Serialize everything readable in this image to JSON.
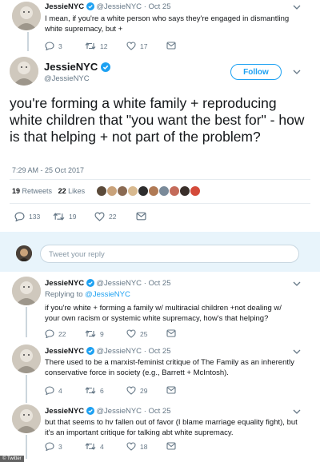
{
  "tweet_top": {
    "name": "JessieNYC",
    "handle": "@JessieNYC",
    "date": "Oct 25",
    "text": "I mean, if you're a white person who says they're engaged in dismantling white supremacy, but +",
    "replies": "3",
    "retweets": "12",
    "likes": "17"
  },
  "main_tweet": {
    "name": "JessieNYC",
    "handle": "@JessieNYC",
    "follow_label": "Follow",
    "text": "you're forming a white family + reproducing white children that \"you want the best for\" - how is that helping + not part of the problem?",
    "timestamp": "7:29 AM - 25 Oct 2017",
    "retweets_count": "19",
    "retweets_label": "Retweets",
    "likes_count": "22",
    "likes_label": "Likes",
    "liker_colors": [
      "#5b4a3a",
      "#c9a27a",
      "#8a6a52",
      "#d8b98f",
      "#2d2d2d",
      "#b07a55",
      "#7a8a99",
      "#c46b5a",
      "#3a2f2a",
      "#d44a3a"
    ],
    "replies": "133",
    "retweets": "19",
    "likes": "22"
  },
  "reply_box": {
    "placeholder": "Tweet your reply"
  },
  "replies": [
    {
      "name": "JessieNYC",
      "handle": "@JessieNYC",
      "date": "Oct 25",
      "replying_prefix": "Replying to",
      "replying_to": "@JessieNYC",
      "text": "if you're white + forming a family w/ multiracial children +not dealing w/ your own racism or systemic white supremacy, how's that helping?",
      "replies": "22",
      "retweets": "9",
      "likes": "25"
    },
    {
      "name": "JessieNYC",
      "handle": "@JessieNYC",
      "date": "Oct 25",
      "text": "There used to be a marxist-feminist critique of The Family as an inherently conservative force in society (e.g., Barrett + McIntosh).",
      "replies": "4",
      "retweets": "6",
      "likes": "29"
    },
    {
      "name": "JessieNYC",
      "handle": "@JessieNYC",
      "date": "Oct 25",
      "text": "but that seems to hv fallen out of favor (I blame marriage equality fight), but it's an important critique for talking abt white supremacy.",
      "replies": "3",
      "retweets": "4",
      "likes": "18"
    }
  ],
  "credit": "© Twitter",
  "colors": {
    "accent": "#1da1f2",
    "muted": "#657786",
    "text": "#14171a",
    "divider": "#e6ecf0"
  }
}
